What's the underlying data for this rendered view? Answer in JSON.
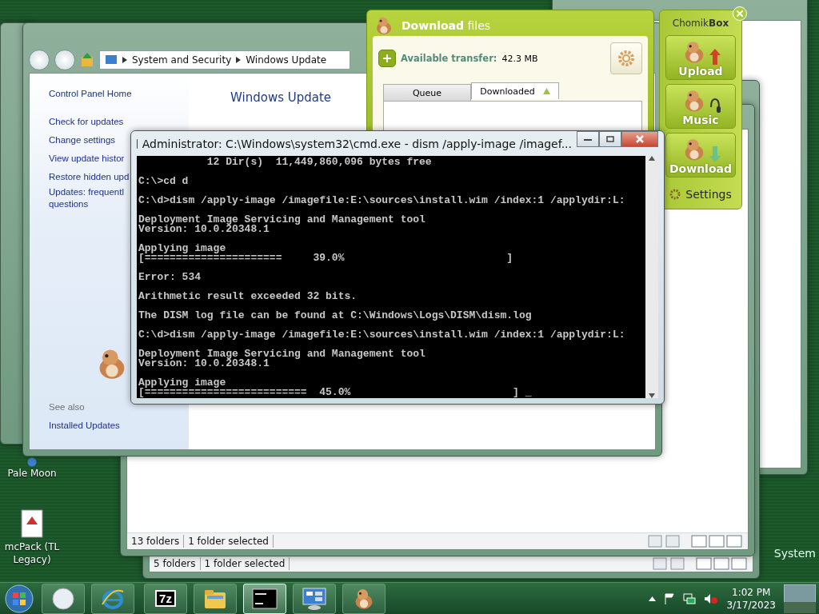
{
  "desktop": {
    "icons": [
      {
        "label": "Pale Moon",
        "kind": "browser"
      },
      {
        "label": "mcPack (TL Legacy)",
        "kind": "package"
      }
    ],
    "corner_text": "System"
  },
  "explorer_back": {
    "status": [
      "5 folders",
      "1 folder selected"
    ]
  },
  "explorer_front": {
    "status": [
      "13 folders",
      "1 folder selected"
    ]
  },
  "control_panel": {
    "breadcrumb": [
      "System and Security",
      "Windows Update"
    ],
    "home": "Control Panel Home",
    "tasks": [
      "Check for updates",
      "Change settings",
      "View update histor",
      "Restore hidden upd",
      "Updates: frequentl",
      "questions"
    ],
    "see_also_heading": "See also",
    "see_also": [
      "Installed Updates"
    ],
    "title": "Windows Update"
  },
  "download_window": {
    "title_bold": "Download",
    "title_rest": "files",
    "transfer_label": "Available transfer:",
    "transfer_value": "42.3 MB",
    "tabs": [
      {
        "label": "Queue",
        "selected": false
      },
      {
        "label": "Downloaded",
        "selected": true
      }
    ]
  },
  "chomikbox": {
    "title_light": "Chomik",
    "title_bold": "Box",
    "buttons": [
      {
        "label": "Upload",
        "kind": "upload"
      },
      {
        "label": "Music",
        "kind": "music"
      },
      {
        "label": "Download",
        "kind": "download"
      }
    ],
    "settings": "Settings"
  },
  "console": {
    "title": "Administrator: C:\\Windows\\system32\\cmd.exe - dism  /apply-image /imagef...",
    "lines": [
      {
        "text": "           12 Dir(s)  11,449,860,096 bytes free",
        "gap": false
      },
      {
        "text": "C:\\>cd d",
        "gap": true
      },
      {
        "text": "C:\\d>dism /apply-image /imagefile:E:\\sources\\install.wim /index:1 /applydir:L:",
        "gap": true
      },
      {
        "text": "Deployment Image Servicing and Management tool",
        "gap": true
      },
      {
        "text": "Version: 10.0.20348.1",
        "gap": false
      },
      {
        "text": "Applying image",
        "gap": true
      },
      {
        "text": "[======================     39.0%                          ]",
        "gap": false
      },
      {
        "text": "Error: 534",
        "gap": true
      },
      {
        "text": "Arithmetic result exceeded 32 bits.",
        "gap": true
      },
      {
        "text": "The DISM log file can be found at C:\\Windows\\Logs\\DISM\\dism.log",
        "gap": true
      },
      {
        "text": "C:\\d>dism /apply-image /imagefile:E:\\sources\\install.wim /index:1 /applydir:L:",
        "gap": true
      },
      {
        "text": "Deployment Image Servicing and Management tool",
        "gap": true
      },
      {
        "text": "Version: 10.0.20348.1",
        "gap": false
      },
      {
        "text": "Applying image",
        "gap": true
      },
      {
        "text": "[==========================  45.0%                          ] _",
        "gap": false
      }
    ]
  },
  "taskbar": {
    "apps": [
      {
        "kind": "media",
        "active": false
      },
      {
        "kind": "ie",
        "active": false
      },
      {
        "kind": "sevenzip",
        "label": "7z",
        "active": false
      },
      {
        "kind": "folder",
        "active": false
      },
      {
        "kind": "cmd",
        "active": true
      },
      {
        "kind": "panel",
        "active": false
      },
      {
        "kind": "hamster",
        "active": false
      }
    ],
    "time": "1:02 PM",
    "date": "3/17/2023"
  }
}
